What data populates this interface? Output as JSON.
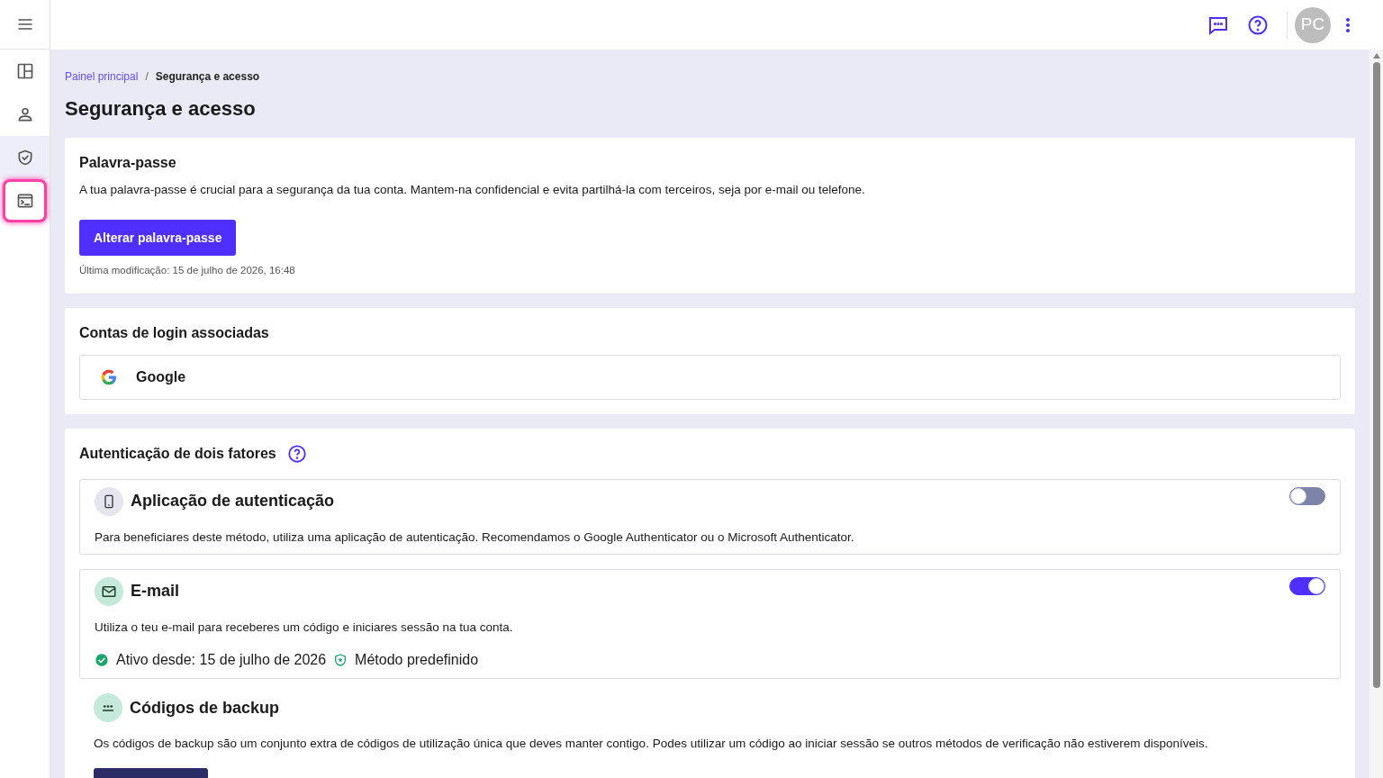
{
  "sidebar": {
    "items": [
      {
        "kind": "dashboard",
        "selected": false,
        "focused": false
      },
      {
        "kind": "profile",
        "selected": false,
        "focused": false
      },
      {
        "kind": "security",
        "selected": true,
        "focused": false
      },
      {
        "kind": "terminal",
        "selected": false,
        "focused": true
      }
    ]
  },
  "topbar": {
    "avatar": "PC"
  },
  "breadcrumb": [
    "Painel principal",
    "/",
    "Segurança e acesso"
  ],
  "title": "Segurança e acesso",
  "password": {
    "heading": "Palavra-passe",
    "text": "A tua palavra-passe é crucial para a segurança da tua conta. Mantem-na confidencial e evita partilhá-la com terceiros, seja por e-mail ou telefone.",
    "button": "Alterar palavra-passe",
    "modified": "Última modificação: 15 de julho de 2026, 16:48"
  },
  "linked_accounts": {
    "heading": "Contas de login associadas",
    "accounts": [
      "Google"
    ]
  },
  "two_factor": {
    "heading": "Autenticação de dois fatores",
    "methods": [
      {
        "kind": "app",
        "title": "Aplicação de autenticação",
        "text": "Para beneficiares deste método, utiliza uma aplicação de autenticação. Recomendamos o Google Authenticator ou o Microsoft Authenticator.",
        "on": false
      },
      {
        "kind": "email",
        "title": "E-mail",
        "text": "Utiliza o teu e-mail para receberes um código e iniciares sessão na tua conta.",
        "on": true,
        "active_since": "Ativo desde: 15 de julho de 2026",
        "default_label": "Método predefinido"
      },
      {
        "kind": "backup",
        "title": "Códigos de backup",
        "text": "Os códigos de backup são um conjunto extra de códigos de utilização única que deves manter contigo. Podes utilizar um código ao iniciar sessão se outros métodos de verificação não estiverem disponíveis."
      }
    ]
  }
}
